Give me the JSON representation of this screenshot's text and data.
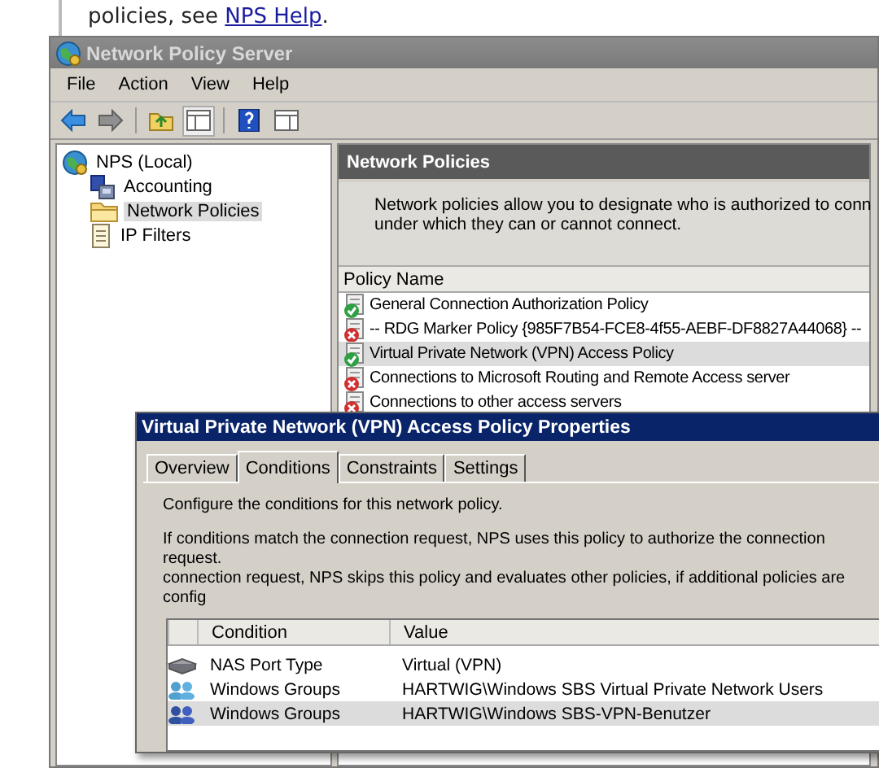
{
  "help_text": {
    "before": "policies, see ",
    "link": "NPS Help",
    "after": "."
  },
  "nps": {
    "title": "Network Policy Server",
    "menu": [
      "File",
      "Action",
      "View",
      "Help"
    ],
    "tree": {
      "label": "NPS (Local)",
      "children": [
        {
          "label": "Accounting",
          "kind": "accounting",
          "selected": false
        },
        {
          "label": "Network Policies",
          "kind": "folder",
          "selected": true
        },
        {
          "label": "IP Filters",
          "kind": "document",
          "selected": false
        }
      ]
    },
    "panel": {
      "title": "Network Policies",
      "description": [
        "Network policies allow you to designate who is authorized to conn",
        "under which they can or cannot connect."
      ],
      "column": "Policy Name",
      "policies": [
        {
          "name": "General Connection Authorization Policy",
          "enabled": true,
          "selected": false
        },
        {
          "name": "-- RDG Marker Policy {985F7B54-FCE8-4f55-AEBF-DF8827A44068} --",
          "enabled": false,
          "selected": false
        },
        {
          "name": "Virtual Private Network (VPN) Access Policy",
          "enabled": true,
          "selected": true
        },
        {
          "name": "Connections to Microsoft Routing and Remote Access server",
          "enabled": false,
          "selected": false
        },
        {
          "name": "Connections to other access servers",
          "enabled": false,
          "selected": false
        }
      ]
    }
  },
  "dialog": {
    "title": "Virtual Private Network (VPN) Access Policy Properties",
    "tabs": [
      {
        "label": "Overview",
        "selected": false
      },
      {
        "label": "Conditions",
        "selected": true
      },
      {
        "label": "Constraints",
        "selected": false
      },
      {
        "label": "Settings",
        "selected": false
      }
    ],
    "intro": "Configure the conditions for this network policy.",
    "explanation": [
      "If conditions match the connection request, NPS uses this policy to authorize the connection request.",
      "connection request, NPS skips this policy and evaluates other policies, if additional policies are config"
    ],
    "columns": [
      "Condition",
      "Value"
    ],
    "conditions": [
      {
        "kind": "port",
        "condition": "NAS Port Type",
        "value": "Virtual (VPN)",
        "selected": false
      },
      {
        "kind": "group",
        "condition": "Windows Groups",
        "value": "HARTWIG\\Windows SBS Virtual Private Network Users",
        "selected": false
      },
      {
        "kind": "group",
        "condition": "Windows Groups",
        "value": "HARTWIG\\Windows SBS-VPN-Benutzer",
        "selected": true
      }
    ]
  }
}
